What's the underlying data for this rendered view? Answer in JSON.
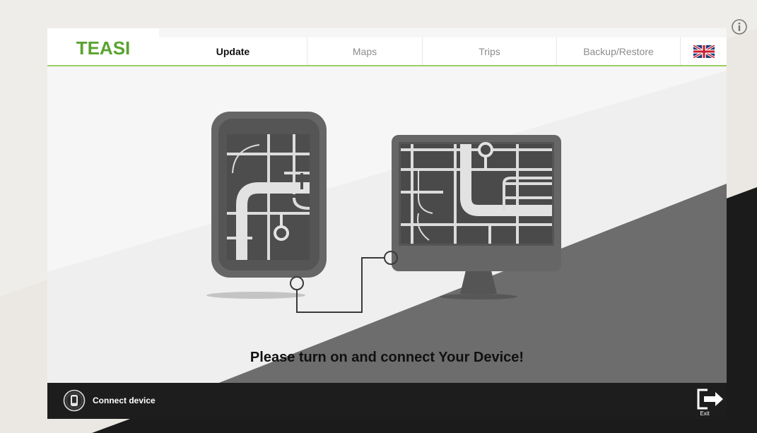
{
  "app": {
    "logo_text": "TEASI"
  },
  "tabs": [
    {
      "label": "Update",
      "active": true
    },
    {
      "label": "Maps",
      "active": false
    },
    {
      "label": "Trips",
      "active": false
    },
    {
      "label": "Backup/Restore",
      "active": false
    }
  ],
  "language": {
    "icon": "uk-flag-icon"
  },
  "main": {
    "message": "Please turn on and connect Your Device!"
  },
  "bottom_bar": {
    "connect_label": "Connect device",
    "connect_icon": "device-icon",
    "exit_label": "Exit",
    "exit_icon": "exit-icon"
  },
  "colors": {
    "accent_green": "#9ccf63",
    "bottom_bar": "#1d1d1d"
  }
}
